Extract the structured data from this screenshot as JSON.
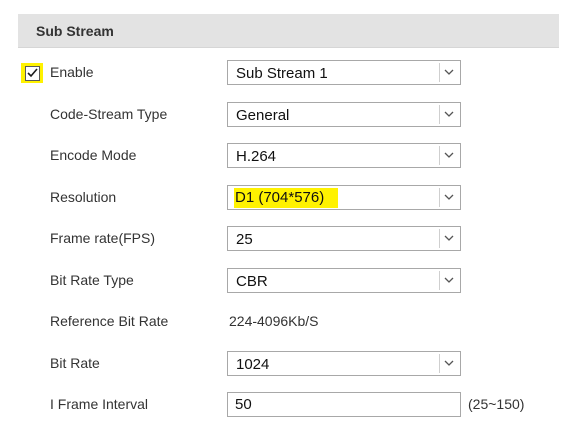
{
  "section": {
    "title": "Sub Stream"
  },
  "colors": {
    "highlight": "#fff200",
    "header_bg": "#e3e3e3"
  },
  "fields": {
    "enable": {
      "label": "Enable",
      "checked": true,
      "value": "Sub Stream 1"
    },
    "code_stream_type": {
      "label": "Code-Stream Type",
      "value": "General"
    },
    "encode_mode": {
      "label": "Encode Mode",
      "value": "H.264"
    },
    "resolution": {
      "label": "Resolution",
      "value": "D1 (704*576)"
    },
    "frame_rate": {
      "label": "Frame rate(FPS)",
      "value": "25"
    },
    "bit_rate_type": {
      "label": "Bit Rate Type",
      "value": "CBR"
    },
    "reference_bit_rate": {
      "label": "Reference Bit Rate",
      "value": "224-4096Kb/S"
    },
    "bit_rate": {
      "label": "Bit Rate",
      "value": "1024"
    },
    "i_frame_interval": {
      "label": "I Frame Interval",
      "value": "50",
      "range": "(25~150)"
    }
  },
  "icons": {
    "dropdown": "chevron-down-icon",
    "checkbox": "checkmark-icon"
  }
}
